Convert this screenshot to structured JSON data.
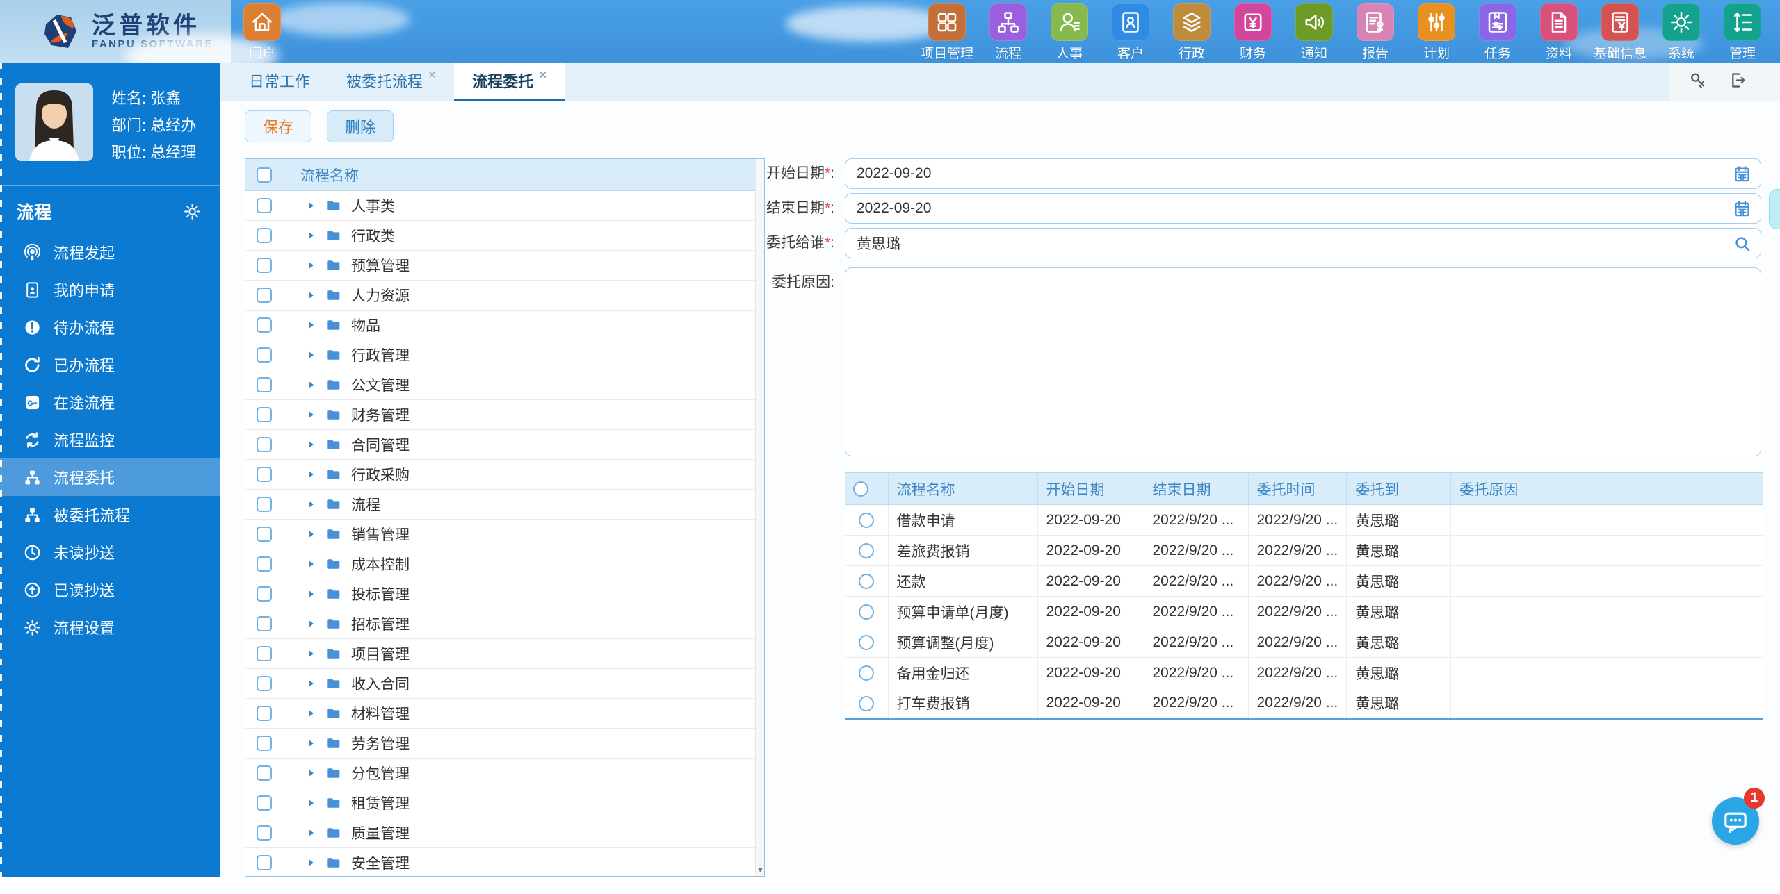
{
  "header": {
    "logo": {
      "title": "泛普软件",
      "subtitle": "FANPU SOFTWARE"
    },
    "portal": {
      "label": "门户",
      "icon": "home-icon",
      "color": "#DD7F33"
    },
    "modules": [
      {
        "label": "项目管理",
        "icon": "grid-icon",
        "color": "#C2703A"
      },
      {
        "label": "流程",
        "icon": "flow-icon",
        "color": "#9A5FDE"
      },
      {
        "label": "人事",
        "icon": "person-icon",
        "color": "#86B94E"
      },
      {
        "label": "客户",
        "icon": "contact-icon",
        "color": "#2F8BE6"
      },
      {
        "label": "行政",
        "icon": "layers-icon",
        "color": "#BE8C3C"
      },
      {
        "label": "财务",
        "icon": "yuan-icon",
        "color": "#D2479C"
      },
      {
        "label": "通知",
        "icon": "speaker-icon",
        "color": "#6D9B26"
      },
      {
        "label": "报告",
        "icon": "report-icon",
        "color": "#D783B4"
      },
      {
        "label": "计划",
        "icon": "sliders-icon",
        "color": "#E89020"
      },
      {
        "label": "任务",
        "icon": "task-icon",
        "color": "#8B66E6"
      },
      {
        "label": "资料",
        "icon": "document-icon",
        "color": "#D8507C"
      },
      {
        "label": "基础信息",
        "icon": "doc-yuan-icon",
        "color": "#D45252"
      },
      {
        "label": "系统",
        "icon": "gear-icon",
        "color": "#12A28D"
      },
      {
        "label": "管理",
        "icon": "sort-list-icon",
        "color": "#12A28D"
      }
    ]
  },
  "sidebar": {
    "profile": {
      "name": "姓名: 张鑫",
      "dept": "部门: 总经办",
      "title": "职位: 总经理"
    },
    "section": {
      "title": "流程",
      "gear_icon": "gear-icon"
    },
    "items": [
      {
        "label": "流程发起",
        "icon": "podcast-icon"
      },
      {
        "label": "我的申请",
        "icon": "id-card-icon"
      },
      {
        "label": "待办流程",
        "icon": "exclamation-circle-icon"
      },
      {
        "label": "已办流程",
        "icon": "rotate-right-icon"
      },
      {
        "label": "在途流程",
        "icon": "gplus-icon"
      },
      {
        "label": "流程监控",
        "icon": "sync-icon"
      },
      {
        "label": "流程委托",
        "icon": "sitemap-icon",
        "active": true
      },
      {
        "label": "被委托流程",
        "icon": "sitemap-icon"
      },
      {
        "label": "未读抄送",
        "icon": "clock-icon"
      },
      {
        "label": "已读抄送",
        "icon": "arrow-up-circle-icon"
      },
      {
        "label": "流程设置",
        "icon": "gear-icon"
      }
    ]
  },
  "tabbar": {
    "tabs": [
      {
        "label": "日常工作",
        "closable": false
      },
      {
        "label": "被委托流程",
        "closable": true
      },
      {
        "label": "流程委托",
        "closable": true,
        "active": true
      }
    ]
  },
  "toolbar": {
    "save_label": "保存",
    "delete_label": "删除"
  },
  "tree": {
    "header": "流程名称",
    "items": [
      "人事类",
      "行政类",
      "预算管理",
      "人力资源",
      "物品",
      "行政管理",
      "公文管理",
      "财务管理",
      "合同管理",
      "行政采购",
      "流程",
      "销售管理",
      "成本控制",
      "投标管理",
      "招标管理",
      "项目管理",
      "收入合同",
      "材料管理",
      "劳务管理",
      "分包管理",
      "租赁管理",
      "质量管理",
      "安全管理"
    ]
  },
  "form": {
    "start_date": {
      "label": "开始日期",
      "required": "*",
      "colon": ":",
      "value": "2022-09-20"
    },
    "end_date": {
      "label": "结束日期",
      "required": "*",
      "colon": ":",
      "value": "2022-09-20"
    },
    "delegate_to": {
      "label": "委托给谁",
      "required": "*",
      "colon": ":",
      "value": "黄思璐"
    },
    "reason": {
      "label": "委托原因",
      "colon": ":",
      "value": ""
    }
  },
  "delegation_table": {
    "columns": [
      "流程名称",
      "开始日期",
      "结束日期",
      "委托时间",
      "委托到",
      "委托原因"
    ],
    "rows": [
      {
        "name": "借款申请",
        "start": "2022-09-20",
        "end": "2022/9/20 ...",
        "time": "2022/9/20 ...",
        "to": "黄思璐",
        "reason": ""
      },
      {
        "name": "差旅费报销",
        "start": "2022-09-20",
        "end": "2022/9/20 ...",
        "time": "2022/9/20 ...",
        "to": "黄思璐",
        "reason": ""
      },
      {
        "name": "还款",
        "start": "2022-09-20",
        "end": "2022/9/20 ...",
        "time": "2022/9/20 ...",
        "to": "黄思璐",
        "reason": ""
      },
      {
        "name": "预算申请单(月度)",
        "start": "2022-09-20",
        "end": "2022/9/20 ...",
        "time": "2022/9/20 ...",
        "to": "黄思璐",
        "reason": ""
      },
      {
        "name": "预算调整(月度)",
        "start": "2022-09-20",
        "end": "2022/9/20 ...",
        "time": "2022/9/20 ...",
        "to": "黄思璐",
        "reason": ""
      },
      {
        "name": "备用金归还",
        "start": "2022-09-20",
        "end": "2022/9/20 ...",
        "time": "2022/9/20 ...",
        "to": "黄思璐",
        "reason": ""
      },
      {
        "name": "打车费报销",
        "start": "2022-09-20",
        "end": "2022/9/20 ...",
        "time": "2022/9/20 ...",
        "to": "黄思璐",
        "reason": ""
      }
    ]
  },
  "chat": {
    "badge": "1"
  },
  "colors": {
    "accent": "#0d7ad2",
    "tab_active_underline": "#1a6cb0",
    "badge_red": "#e8382e",
    "fab_blue": "#2ba6e4"
  }
}
